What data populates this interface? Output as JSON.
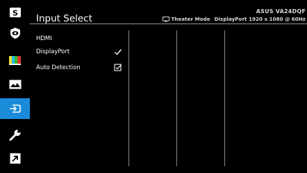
{
  "header": {
    "title": "Input Select",
    "model": "ASUS VA24DQF",
    "mode": "Theater Mode",
    "signal": "DisplayPort 1920 x 1080 @ 60Hz"
  },
  "sidebar": {
    "items": [
      {
        "icon": "s-logo-icon",
        "active": false
      },
      {
        "icon": "shield-icon",
        "active": false
      },
      {
        "icon": "color-bars-icon",
        "active": false
      },
      {
        "icon": "image-icon",
        "active": false
      },
      {
        "icon": "input-select-icon",
        "active": true
      },
      {
        "icon": "wrench-icon",
        "active": false
      },
      {
        "icon": "shortcut-icon",
        "active": false
      }
    ]
  },
  "options": [
    {
      "label": "HDMI",
      "state": "none"
    },
    {
      "label": "DisplayPort",
      "state": "selected"
    },
    {
      "label": "Auto Detection",
      "state": "checked"
    }
  ],
  "colors": {
    "accent": "#1a8bd8",
    "background": "#000000",
    "divider": "#8a8a8a"
  }
}
